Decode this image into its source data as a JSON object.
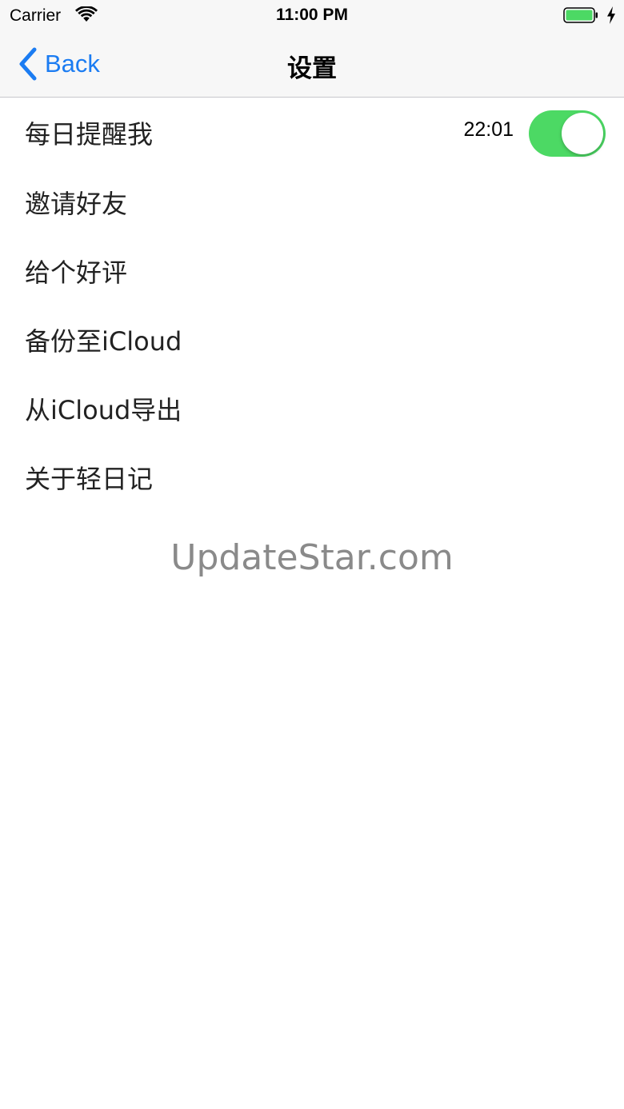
{
  "status_bar": {
    "carrier": "Carrier",
    "time": "11:00 PM",
    "wifi_icon": "wifi-icon",
    "battery_icon": "battery-full-icon",
    "charging_icon": "charging-bolt-icon",
    "battery_color": "#4cd964"
  },
  "nav": {
    "back_label": "Back",
    "back_icon": "chevron-left-icon",
    "title": "设置",
    "accent_color": "#1b7cf2"
  },
  "settings": {
    "daily_reminder": {
      "label": "每日提醒我",
      "time": "22:01",
      "enabled": true,
      "toggle_color": "#4cd964"
    },
    "items": [
      {
        "label": "邀请好友"
      },
      {
        "label": "给个好评"
      },
      {
        "label": "备份至iCloud"
      },
      {
        "label": "从iCloud导出"
      },
      {
        "label": "关于轻日记"
      }
    ]
  },
  "watermark": "UpdateStar.com"
}
